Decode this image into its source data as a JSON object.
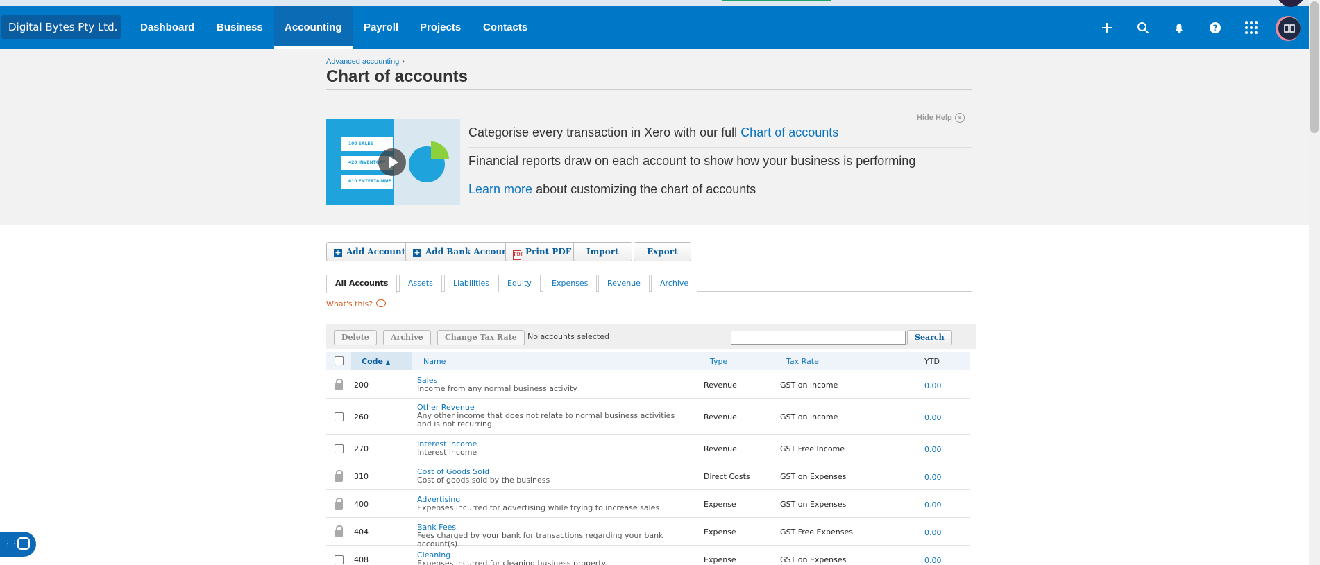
{
  "nav": {
    "org_name": "Digital Bytes Pty Ltd.",
    "items": [
      "Dashboard",
      "Business",
      "Accounting",
      "Payroll",
      "Projects",
      "Contacts"
    ],
    "active": "Accounting"
  },
  "breadcrumb": {
    "parent": "Advanced accounting",
    "separator": "›"
  },
  "page_title": "Chart of accounts",
  "help": {
    "hide_label": "Hide Help",
    "video_labels": [
      "100  SALES",
      "420  INVENTORY",
      "610  ENTERTAINME"
    ],
    "line1_text": "Categorise every transaction in Xero with our full ",
    "line1_link": "Chart of accounts",
    "line2_text": "Financial reports draw on each account to show how your business is performing",
    "line3_link": "Learn more",
    "line3_text": " about customizing the chart of accounts"
  },
  "toolbar": {
    "add_account": "Add Account",
    "add_bank_account": "Add Bank Account",
    "print_pdf": "Print PDF",
    "import": "Import",
    "export": "Export"
  },
  "tabs": [
    "All Accounts",
    "Assets",
    "Liabilities",
    "Equity",
    "Expenses",
    "Revenue",
    "Archive"
  ],
  "whats_this": "What's this?",
  "actions": {
    "delete": "Delete",
    "archive": "Archive",
    "change_tax_rate": "Change Tax Rate",
    "selection_status": "No accounts selected",
    "search_button": "Search",
    "search_value": ""
  },
  "table": {
    "headers": {
      "code": "Code",
      "name": "Name",
      "type": "Type",
      "tax_rate": "Tax Rate",
      "ytd": "YTD"
    },
    "rows": [
      {
        "locked": true,
        "code": "200",
        "name": "Sales",
        "desc": "Income from any normal business activity",
        "type": "Revenue",
        "tax": "GST on Income",
        "ytd": "0.00"
      },
      {
        "locked": false,
        "code": "260",
        "name": "Other Revenue",
        "desc": "Any other income that does not relate to normal business activities and is not recurring",
        "type": "Revenue",
        "tax": "GST on Income",
        "ytd": "0.00"
      },
      {
        "locked": false,
        "code": "270",
        "name": "Interest Income",
        "desc": "Interest income",
        "type": "Revenue",
        "tax": "GST Free Income",
        "ytd": "0.00"
      },
      {
        "locked": true,
        "code": "310",
        "name": "Cost of Goods Sold",
        "desc": "Cost of goods sold by the business",
        "type": "Direct Costs",
        "tax": "GST on Expenses",
        "ytd": "0.00"
      },
      {
        "locked": true,
        "code": "400",
        "name": "Advertising",
        "desc": "Expenses incurred for advertising while trying to increase sales",
        "type": "Expense",
        "tax": "GST on Expenses",
        "ytd": "0.00"
      },
      {
        "locked": true,
        "code": "404",
        "name": "Bank Fees",
        "desc": "Fees charged by your bank for transactions regarding your bank account(s).",
        "type": "Expense",
        "tax": "GST Free Expenses",
        "ytd": "0.00"
      },
      {
        "locked": false,
        "code": "408",
        "name": "Cleaning",
        "desc": "Expenses incurred for cleaning business property.",
        "type": "Expense",
        "tax": "GST on Expenses",
        "ytd": "0.00"
      }
    ]
  },
  "colors": {
    "nav_bg": "#0078c8",
    "link": "#0b75c0",
    "accent_orange": "#d85a1c"
  }
}
